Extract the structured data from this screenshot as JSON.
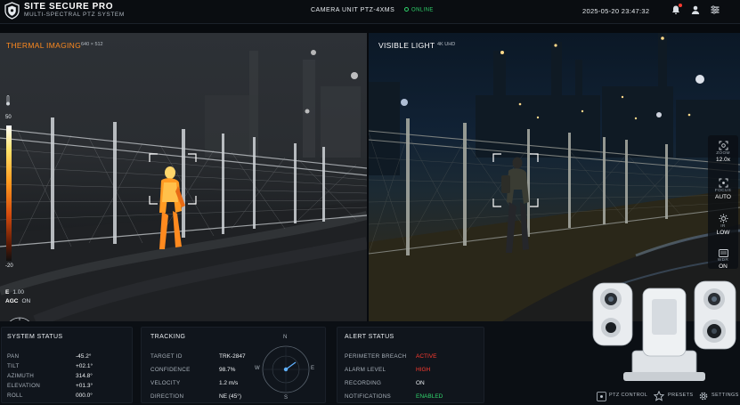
{
  "header": {
    "title": "SITE SECURE PRO",
    "subtitle": "MULTI-SPECTRAL PTZ SYSTEM",
    "camera_unit": "CAMERA UNIT PTZ-4XMS",
    "status": "ONLINE",
    "datetime": "2025-05-20 23:47:32",
    "icons": [
      "bell-icon",
      "user-icon",
      "settings-icon"
    ]
  },
  "thermal": {
    "title": "THERMAL IMAGING",
    "resolution": "640 × 512",
    "scale_high": "50",
    "scale_low": "-20",
    "e_label": "E",
    "e_value": "1.00",
    "agc_label": "AGC",
    "agc_value": "ON"
  },
  "visible": {
    "title": "VISIBLE LIGHT",
    "resolution": "4K UHD"
  },
  "controls": [
    {
      "label": "ZOOM",
      "value": "12.0x",
      "icon": "zoom-icon"
    },
    {
      "label": "FOCUS",
      "value": "AUTO",
      "icon": "focus-icon"
    },
    {
      "label": "IR",
      "value": "LOW",
      "icon": "ir-icon"
    },
    {
      "label": "WDR",
      "value": "ON",
      "icon": "wdr-icon"
    }
  ],
  "system_status": {
    "title": "SYSTEM STATUS",
    "rows": [
      {
        "label": "PAN",
        "value": "-45.2°"
      },
      {
        "label": "TILT",
        "value": "+02.1°"
      },
      {
        "label": "AZIMUTH",
        "value": "314.8°"
      },
      {
        "label": "ELEVATION",
        "value": "+01.3°"
      },
      {
        "label": "ROLL",
        "value": "000.0°"
      }
    ]
  },
  "tracking": {
    "title": "TRACKING",
    "rows": [
      {
        "label": "TARGET ID",
        "value": "TRK-2847"
      },
      {
        "label": "CONFIDENCE",
        "value": "98.7%"
      },
      {
        "label": "VELOCITY",
        "value": "1.2 m/s"
      },
      {
        "label": "DIRECTION",
        "value": "NE (45°)"
      }
    ],
    "compass": {
      "n": "N",
      "e": "E",
      "s": "S",
      "w": "W"
    }
  },
  "alert_status": {
    "title": "ALERT STATUS",
    "rows": [
      {
        "label": "PERIMETER BREACH",
        "value": "ACTIVE",
        "color": "#ff3b30"
      },
      {
        "label": "ALARM LEVEL",
        "value": "HIGH",
        "color": "#ff3b30"
      },
      {
        "label": "RECORDING",
        "value": "ON",
        "color": "#eef1f4"
      },
      {
        "label": "NOTIFICATIONS",
        "value": "ENABLED",
        "color": "#31d46c"
      }
    ]
  },
  "bottom_nav": [
    {
      "label": "PTZ CONTROL",
      "icon": "ptz-control-icon"
    },
    {
      "label": "PRESETS",
      "icon": "star-icon"
    },
    {
      "label": "SETTINGS",
      "icon": "gear-icon"
    }
  ],
  "colors": {
    "accent_thermal": "#ff8a1f",
    "online": "#2fd46b",
    "alert": "#ff3b30",
    "enabled": "#31d46c"
  }
}
